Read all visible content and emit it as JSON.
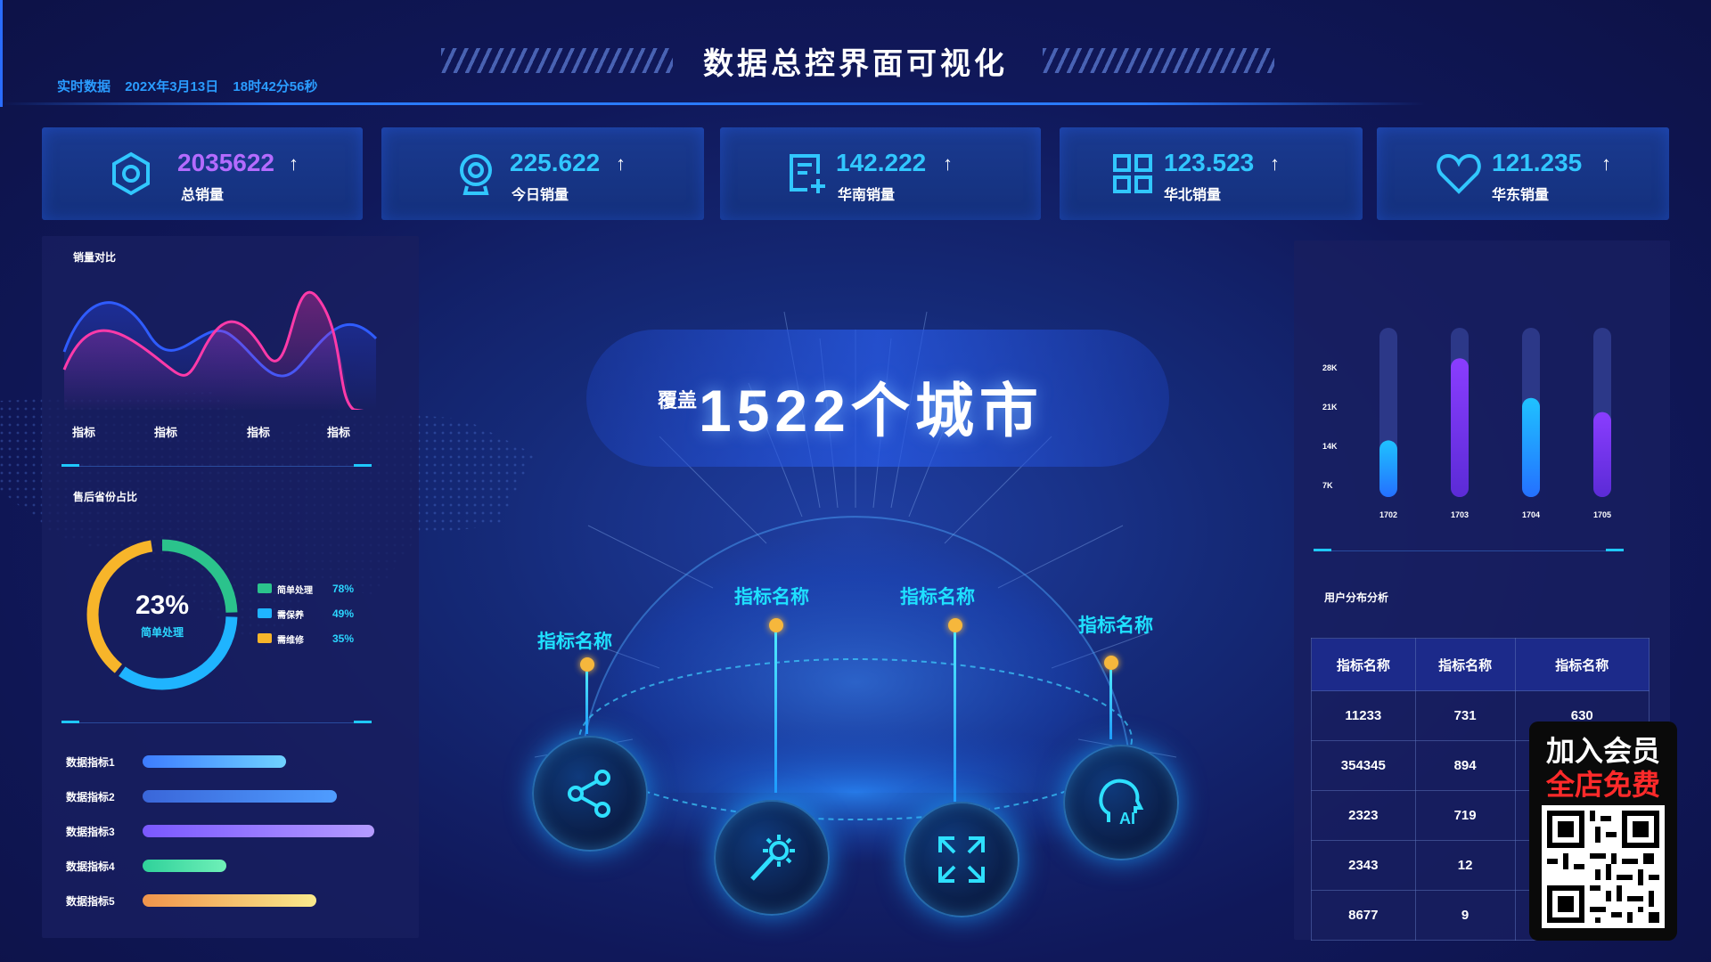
{
  "header": {
    "title": "数据总控界面可视化",
    "realtime_label": "实时数据",
    "date": "202X年3月13日",
    "time": "18时42分56秒"
  },
  "stats": [
    {
      "value": "2035622",
      "label": "总销量",
      "icon": "hexagon-nut-icon",
      "color": "#b46bff"
    },
    {
      "value": "225.622",
      "label": "今日销量",
      "icon": "webcam-icon",
      "color": "#31c7ff"
    },
    {
      "value": "142.222",
      "label": "华南销量",
      "icon": "document-add-icon",
      "color": "#31c7ff"
    },
    {
      "value": "123.523",
      "label": "华北销量",
      "icon": "grid-apps-icon",
      "color": "#31c7ff"
    },
    {
      "value": "121.235",
      "label": "华东销量",
      "icon": "heart-icon",
      "color": "#31c7ff"
    }
  ],
  "stat_arrow": "↑",
  "sales_compare": {
    "title": "销量对比",
    "x_labels": [
      "指标",
      "指标",
      "指标",
      "指标"
    ]
  },
  "aftersale": {
    "title": "售后省份占比",
    "center_value": "23%",
    "center_label": "简单处理",
    "legend": [
      {
        "label": "简单处理",
        "pct": "78%",
        "color": "#2bc38c"
      },
      {
        "label": "需保养",
        "pct": "49%",
        "color": "#1fb4ff"
      },
      {
        "label": "需维修",
        "pct": "35%",
        "color": "#f7b52a"
      }
    ]
  },
  "data_metrics": [
    {
      "label": "数据指标1",
      "value": 0.62,
      "color_from": "#3d7cff",
      "color_to": "#6fd2ff"
    },
    {
      "label": "数据指标2",
      "value": 0.84,
      "color_from": "#3a66d9",
      "color_to": "#4f9dff"
    },
    {
      "label": "数据指标3",
      "value": 1.0,
      "color_from": "#7a58ff",
      "color_to": "#b49bff"
    },
    {
      "label": "数据指标4",
      "value": 0.36,
      "color_from": "#2fd19a",
      "color_to": "#6ff0b8"
    },
    {
      "label": "数据指标5",
      "value": 0.75,
      "color_from": "#f0944b",
      "color_to": "#f9e98c"
    }
  ],
  "center": {
    "cover_label": "覆盖",
    "headline": "1522个城市",
    "metric_names": [
      "指标名称",
      "指标名称",
      "指标名称",
      "指标名称"
    ],
    "orb_icons": [
      "share-nodes-icon",
      "magic-wand-icon",
      "expand-arrows-icon",
      "ai-head-icon"
    ]
  },
  "chart_data": {
    "type": "bar",
    "categories": [
      "1702",
      "1703",
      "1704",
      "1705"
    ],
    "values": [
      10000,
      24500,
      17500,
      15000
    ],
    "ylim": [
      0,
      28000
    ],
    "y_ticks": [
      "28K",
      "21K",
      "14K",
      "7K"
    ],
    "colors": [
      "#1fc2ff",
      "#8a3dff",
      "#1fc2ff",
      "#8a3dff"
    ]
  },
  "user_dist": {
    "title": "用户分布分析",
    "headers": [
      "指标名称",
      "指标名称",
      "指标名称"
    ],
    "rows": [
      [
        "11233",
        "731",
        "630"
      ],
      [
        "354345",
        "894",
        ""
      ],
      [
        "2323",
        "719",
        ""
      ],
      [
        "2343",
        "12",
        ""
      ],
      [
        "8677",
        "9",
        ""
      ]
    ]
  },
  "promo": {
    "line1": "加入会员",
    "line2": "全店免费"
  }
}
